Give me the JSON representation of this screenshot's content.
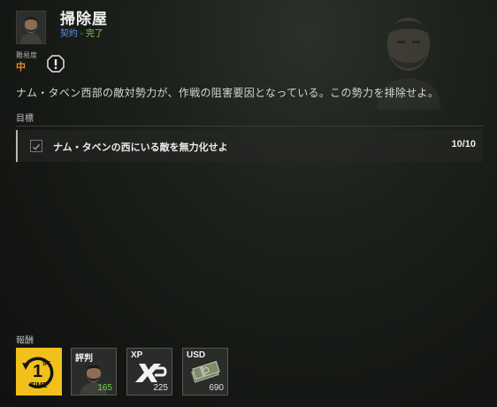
{
  "mission": {
    "title": "掃除屋",
    "type": "契約",
    "separator": " - ",
    "status": "完了"
  },
  "difficulty": {
    "label": "難易度",
    "value": "中",
    "icon": "alert-icon"
  },
  "description": "ナム・タベン西部の敵対勢力が、作戦の阻害要因となっている。この勢力を排除せよ。",
  "objectives": {
    "label": "目標",
    "items": [
      {
        "text": "ナム・タベンの西にいる敵を無力化せよ",
        "progress": "10/10",
        "checked": true
      }
    ]
  },
  "rewards": {
    "label": "報酬",
    "items": [
      {
        "id": "first-time",
        "title": "",
        "value": "",
        "badge_text": "TIME",
        "badge_number": "1",
        "badge_sup": "ST",
        "color": "#f2c01a"
      },
      {
        "id": "reputation",
        "title": "評判",
        "value": "165",
        "value_color": "#6fd04a"
      },
      {
        "id": "xp",
        "title": "XP",
        "value": "225"
      },
      {
        "id": "usd",
        "title": "USD",
        "value": "690"
      }
    ]
  },
  "colors": {
    "type": "#5d8fe0",
    "status": "#7cd04a",
    "difficulty": "#e38a2e",
    "first_time_bg": "#f2c01a"
  }
}
